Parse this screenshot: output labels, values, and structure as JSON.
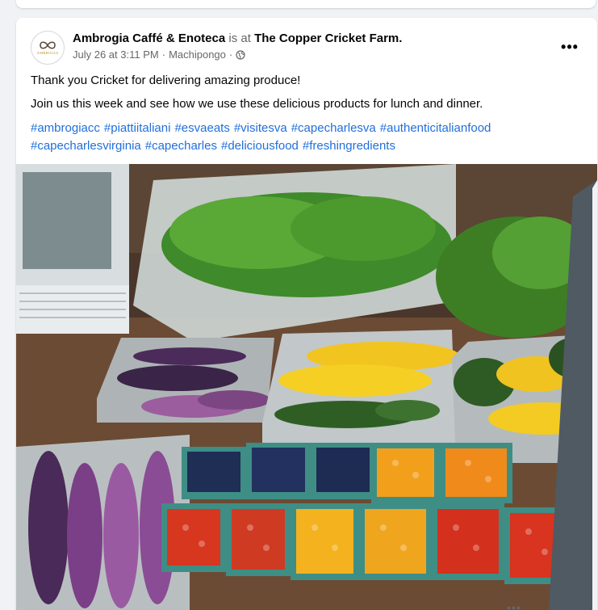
{
  "post": {
    "page_name": "Ambrogia Caffé & Enoteca",
    "is_at_text": "is at",
    "location_name": "The Copper Cricket Farm.",
    "timestamp": "July 26 at 3:11 PM",
    "separator": "·",
    "place": "Machipongo",
    "audience_icon": "globe-icon",
    "avatar_brand": "AMBROGIA",
    "more_label": "•••",
    "line1": "Thank you Cricket for delivering amazing produce!",
    "line2": "Join us this week and see how we use these delicious products for lunch and dinner.",
    "hashtags": [
      "#ambrogiacc",
      "#piattiitaliani",
      "#esvaeats",
      "#visitesva",
      "#capecharlesva",
      "#authenticitalianfood",
      "#capecharlesvirginia",
      "#capecharles",
      "#deliciousfood",
      "#freshingredients"
    ],
    "photo_subject": "produce-photo"
  },
  "next_post": {
    "more_label": "•••"
  },
  "colors": {
    "link": "#216fdb",
    "muted": "#65676b",
    "text": "#050505"
  }
}
